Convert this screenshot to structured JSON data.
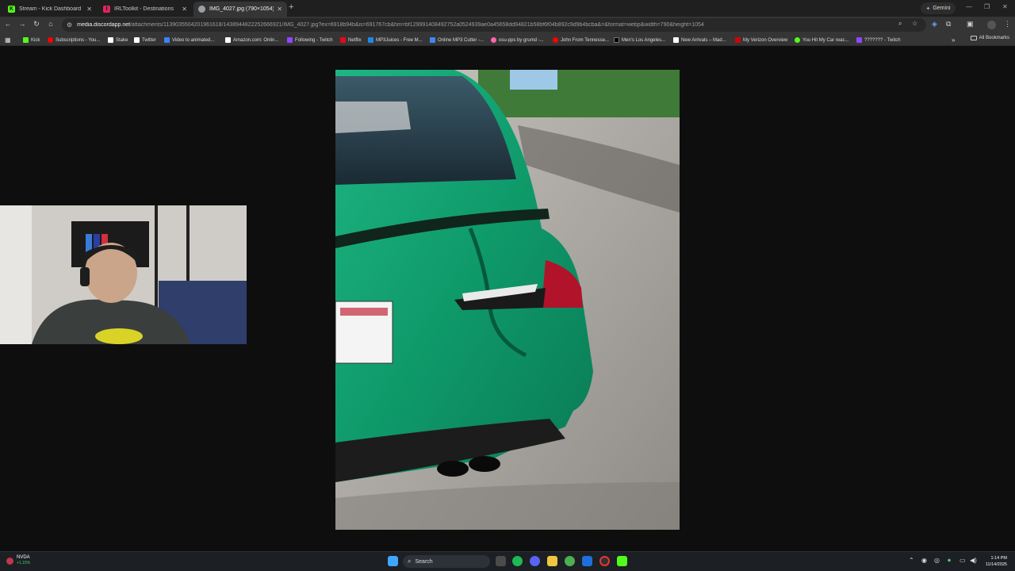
{
  "tabs": [
    {
      "title": "Stream - Kick Dashboard",
      "color": "#53fc18",
      "glyph": "K"
    },
    {
      "title": "IRLToolkit - Destinations",
      "color": "#e0245e",
      "glyph": "I"
    },
    {
      "title": "IMG_4027.jpg (790×1054)",
      "color": "#9aa0a6",
      "glyph": ""
    }
  ],
  "gemini_label": "Gemini",
  "address": {
    "host": "media.discordapp.net",
    "path": "/attachments/1139035504201961618/1438944822252666921/IMG_4027.jpg?ex=6918b94b&is=691767cb&hm=bf129991408492752a0524939ae0a45658dd94821b58bf6f04b892c9d9b4bcba&=&format=webp&width=790&height=1054"
  },
  "bookmarks": [
    {
      "label": "Kick",
      "color": "#53fc18"
    },
    {
      "label": "Subscriptions - You...",
      "color": "#ff0000"
    },
    {
      "label": "Stake",
      "color": "#ffffff"
    },
    {
      "label": "Twitter",
      "color": "#ffffff"
    },
    {
      "label": "Video to animated...",
      "color": "#3b82f6"
    },
    {
      "label": "Amazon.com: Onlin...",
      "color": "#ffffff"
    },
    {
      "label": "Following - Twitch",
      "color": "#9146ff"
    },
    {
      "label": "Netflix",
      "color": "#e50914"
    },
    {
      "label": "MP3Juices - Free M...",
      "color": "#1e88e5"
    },
    {
      "label": "Online MP3 Cutter -...",
      "color": "#4285f4"
    },
    {
      "label": "osu-pps by grumd -...",
      "color": "#ff66aa"
    },
    {
      "label": "John From Tennesse...",
      "color": "#ff0000"
    },
    {
      "label": "Men's Los Angeles...",
      "color": "#000000"
    },
    {
      "label": "New Arrivals – Mad...",
      "color": "#ffffff"
    },
    {
      "label": "My Verizon Overview",
      "color": "#cd040b"
    },
    {
      "label": "You Hit My Car reac...",
      "color": "#53fc18"
    },
    {
      "label": "??????? - Twitch",
      "color": "#9146ff"
    }
  ],
  "all_bookmarks": "All Bookmarks",
  "taskbar": {
    "stock_name": "NVDA",
    "stock_change": "+1.15%",
    "search_placeholder": "Search",
    "time": "1:14 PM",
    "date": "11/14/2025"
  }
}
